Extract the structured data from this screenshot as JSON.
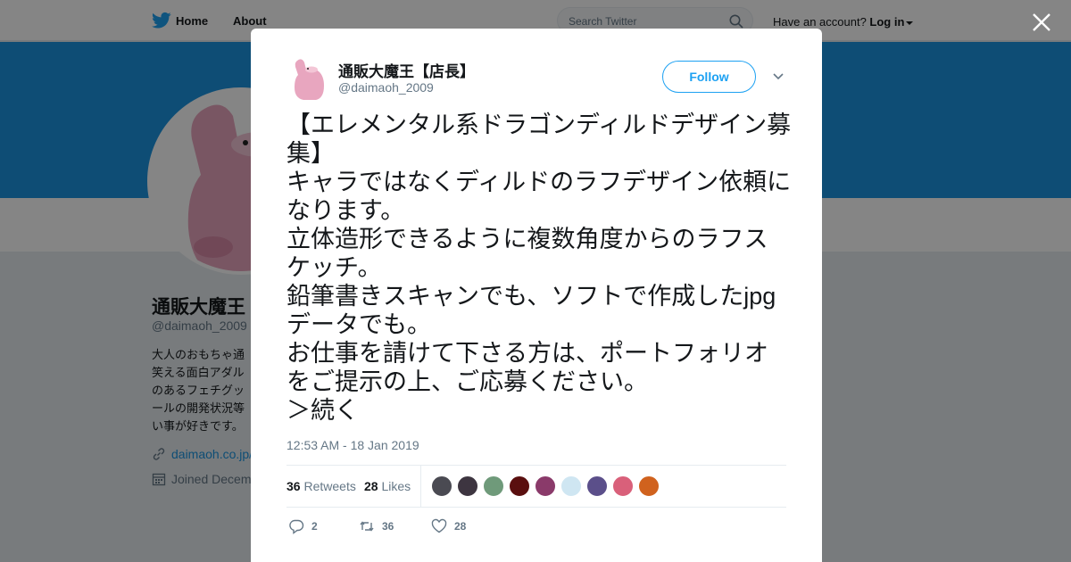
{
  "nav": {
    "home_label": "Home",
    "about_label": "About",
    "search_placeholder": "Search Twitter",
    "have_account": "Have an account?",
    "login_label": "Log in"
  },
  "profile": {
    "name": "通販大魔王",
    "handle": "@daimaoh_2009",
    "bio": "大人のおもちゃ通\n笑える面白アダル\nのあるフェチグッ\nールの開発状況等\nい事が好きです。",
    "link": "daimaoh.co.jp/",
    "joined": "Joined Decem"
  },
  "tweet": {
    "author_name": "通販大魔王【店長】",
    "author_handle": "@daimaoh_2009",
    "follow_label": "Follow",
    "text": "【エレメンタル系ドラゴンディルドデザイン募集】\nキャラではなくディルドのラフデザイン依頼になります。\n立体造形できるように複数角度からのラフスケッチ。\n鉛筆書きスキャンでも、ソフトで作成したjpgデータでも。\nお仕事を請けて下さる方は、ポートフォリオをご提示の上、ご応募ください。\n＞続く",
    "timestamp": "12:53 AM - 18 Jan 2019",
    "retweet_count": "36",
    "retweet_label": "Retweets",
    "like_count": "28",
    "like_label": "Likes",
    "reply_action_count": "2",
    "retweet_action_count": "36",
    "like_action_count": "28",
    "liker_colors": [
      "#4a4a52",
      "#3d3540",
      "#6f9a7a",
      "#5a0f0f",
      "#8a3a6a",
      "#cfe6f2",
      "#5b4f8a",
      "#d9607a",
      "#d0621e"
    ]
  },
  "colors": {
    "accent": "#1da1f2",
    "banner": "#1b95e0",
    "avatar_pink": "#e8a6bf"
  }
}
